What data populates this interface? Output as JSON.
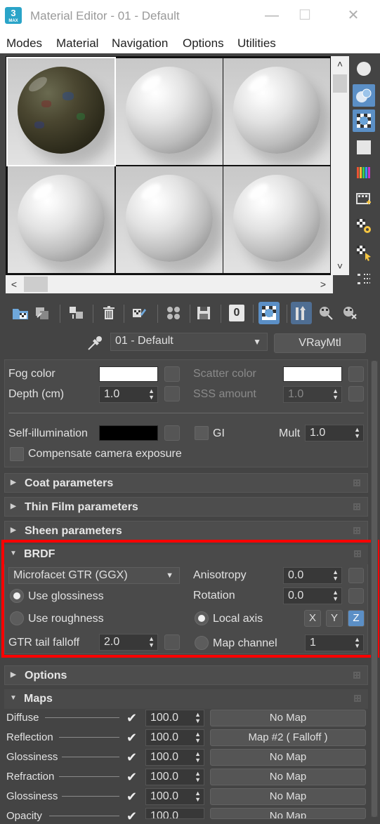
{
  "window": {
    "title": "Material Editor - 01 - Default",
    "app_icon_text": "3",
    "app_icon_sub": "MAX",
    "minimize": "—",
    "maximize": "☐",
    "close": "✕"
  },
  "menu": [
    "Modes",
    "Material",
    "Navigation",
    "Options",
    "Utilities"
  ],
  "material": {
    "name": "01 - Default",
    "type": "VRayMtl"
  },
  "fog": {
    "fog_color_label": "Fog color",
    "fog_color": "#ffffff",
    "depth_label": "Depth (cm)",
    "depth_value": "1.0",
    "scatter_color_label": "Scatter color",
    "scatter_color": "#ffffff",
    "sss_amount_label": "SSS amount",
    "sss_amount_value": "1.0"
  },
  "self_illum": {
    "label": "Self-illumination",
    "color": "#000000",
    "gi_label": "GI",
    "mult_label": "Mult",
    "mult_value": "1.0",
    "compensate_label": "Compensate camera exposure"
  },
  "rollouts": {
    "coat": "Coat parameters",
    "thin_film": "Thin Film parameters",
    "sheen": "Sheen parameters",
    "brdf": "BRDF",
    "options": "Options",
    "maps": "Maps"
  },
  "brdf": {
    "type": "Microfacet GTR (GGX)",
    "use_glossiness": "Use glossiness",
    "use_roughness": "Use roughness",
    "gtr_tail_label": "GTR tail falloff",
    "gtr_tail_value": "2.0",
    "anisotropy_label": "Anisotropy",
    "anisotropy_value": "0.0",
    "rotation_label": "Rotation",
    "rotation_value": "0.0",
    "local_axis_label": "Local axis",
    "axis_x": "X",
    "axis_y": "Y",
    "axis_z": "Z",
    "map_channel_label": "Map channel",
    "map_channel_value": "1"
  },
  "maps": [
    {
      "name": "Diffuse",
      "checked": true,
      "amount": "100.0",
      "map": "No Map"
    },
    {
      "name": "Reflection",
      "checked": true,
      "amount": "100.0",
      "map": "Map #2  ( Falloff )"
    },
    {
      "name": "Glossiness",
      "checked": true,
      "amount": "100.0",
      "map": "No Map"
    },
    {
      "name": "Refraction",
      "checked": true,
      "amount": "100.0",
      "map": "No Map"
    },
    {
      "name": "Glossiness",
      "checked": true,
      "amount": "100.0",
      "map": "No Map"
    },
    {
      "name": "Opacity",
      "checked": true,
      "amount": "100.0",
      "map": "No Map"
    }
  ],
  "toolbar_zero": "0",
  "colors": {
    "accent": "#5b8fc6",
    "highlight_box": "#ff0000",
    "panel_bg": "#444444"
  }
}
